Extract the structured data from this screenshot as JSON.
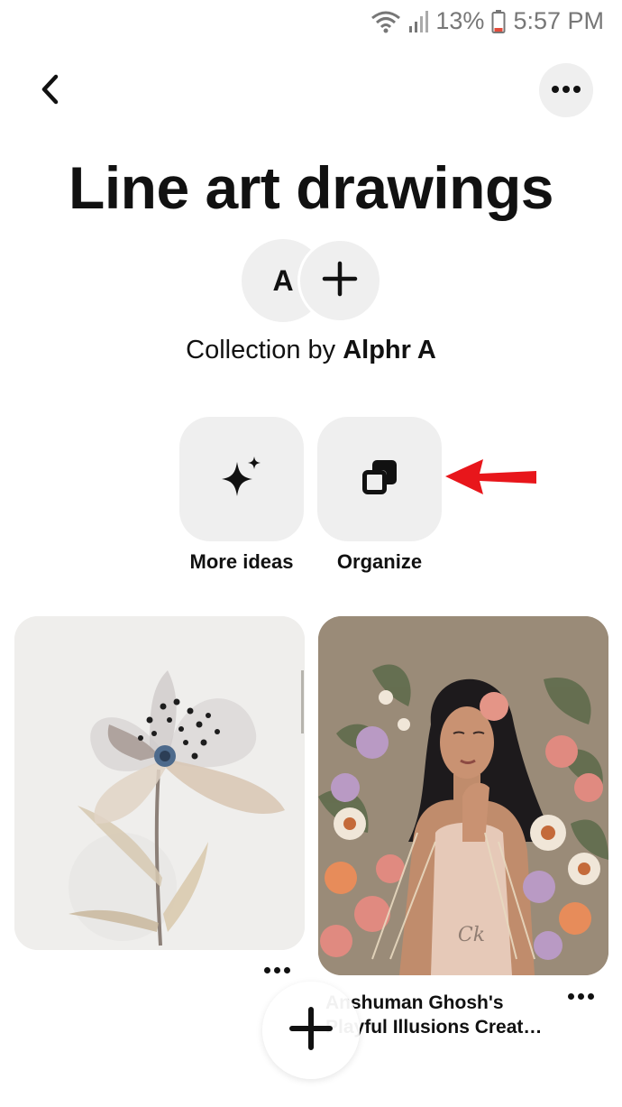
{
  "status_bar": {
    "battery_percent": "13%",
    "time": "5:57 PM",
    "icons": [
      "wifi-icon",
      "signal-icon",
      "battery-icon"
    ]
  },
  "header": {
    "back_icon": "chevron-left-icon",
    "more_icon": "ellipsis-icon"
  },
  "board": {
    "title": "Line art drawings",
    "owner_initial": "A",
    "add_collaborator_icon": "plus-icon",
    "collection_prefix": "Collection by",
    "owner_name": "Alphr A"
  },
  "actions": [
    {
      "label": "More ideas",
      "icon": "sparkle-icon"
    },
    {
      "label": "Organize",
      "icon": "organize-icon"
    }
  ],
  "annotation": {
    "arrow_color": "#e8161b"
  },
  "pins": [
    {
      "image": "poppy-line-art",
      "title": ""
    },
    {
      "image": "woman-with-flowers-illustration",
      "title": "Anshuman Ghosh's Playful Illusions Creat…"
    }
  ],
  "fab_icon": "plus-icon",
  "colors": {
    "tile_bg": "#efefef",
    "text": "#111111"
  }
}
